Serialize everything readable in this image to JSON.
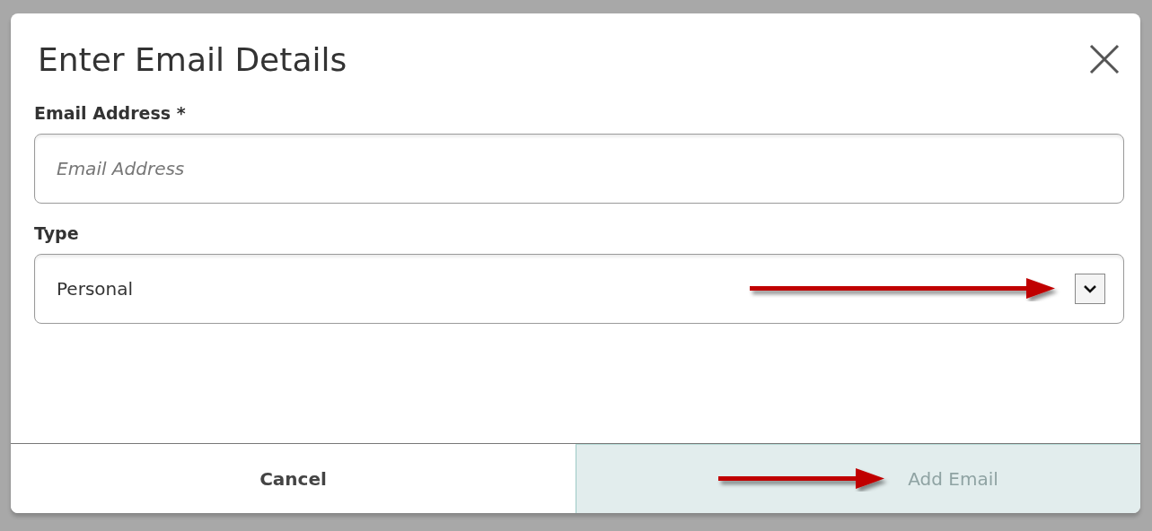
{
  "dialog": {
    "title": "Enter Email Details"
  },
  "fields": [
    {
      "kind": "text",
      "label": "Email Address *",
      "placeholder": "Email Address"
    },
    {
      "kind": "select",
      "label": "Type",
      "value": "Personal"
    }
  ],
  "buttons": [
    {
      "label": "Cancel",
      "disabled": false
    },
    {
      "label": "Add Email",
      "disabled": true
    }
  ]
}
